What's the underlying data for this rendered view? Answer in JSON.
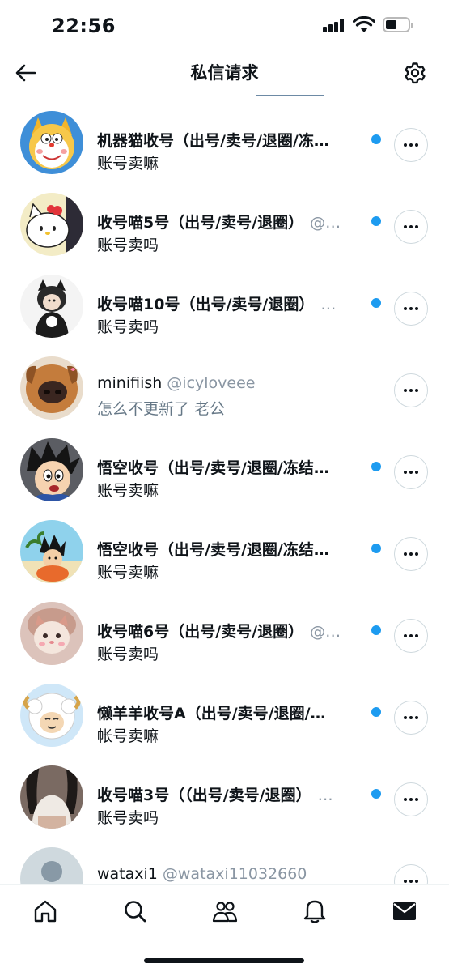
{
  "status_bar": {
    "time": "22:56"
  },
  "header": {
    "title": "私信请求"
  },
  "conversations": [
    {
      "name": "机器猫收号（出号/卖号/退圈/冻…",
      "handle": "",
      "preview": "账号卖嘛",
      "unread": true,
      "avatar": "doraemon-avatar"
    },
    {
      "name": "收号喵5号（出号/卖号/退圈）",
      "handle": "@…",
      "preview": "账号卖吗",
      "unread": true,
      "avatar": "hello-kitty-avatar"
    },
    {
      "name": "收号喵10号（出号/卖号/退圈）",
      "handle": "…",
      "preview": "账号卖吗",
      "unread": true,
      "avatar": "cat-girl-avatar"
    },
    {
      "name": "minifiish",
      "handle": "@icyloveee",
      "preview": "怎么不更新了 老公",
      "unread": false,
      "avatar": "dog-nose-avatar"
    },
    {
      "name": "悟空收号（出号/卖号/退圈/冻结…",
      "handle": "",
      "preview": "账号卖嘛",
      "unread": true,
      "avatar": "goku-avatar"
    },
    {
      "name": "悟空收号（出号/卖号/退圈/冻结…",
      "handle": "",
      "preview": "账号卖嘛",
      "unread": true,
      "avatar": "goku-beach-avatar"
    },
    {
      "name": "收号喵6号（出号/卖号/退圈）",
      "handle": "@…",
      "preview": "账号卖吗",
      "unread": true,
      "avatar": "cat-meme-avatar"
    },
    {
      "name": "懒羊羊收号A（出号/卖号/退圈/…",
      "handle": "",
      "preview": "帐号卖嘛",
      "unread": true,
      "avatar": "lazy-sheep-avatar"
    },
    {
      "name": "收号喵3号（（出号/卖号/退圈）",
      "handle": "…",
      "preview": "账号卖吗",
      "unread": true,
      "avatar": "photo-avatar"
    },
    {
      "name": "wataxi1",
      "handle": "@wataxi11032660",
      "preview": "",
      "unread": false,
      "avatar": "default-avatar"
    }
  ],
  "colors": {
    "unread_dot": "#1d9bf0",
    "text": "#0f1419",
    "muted": "#657786"
  },
  "tab_bar": [
    "home-icon",
    "search-icon",
    "communities-icon",
    "notifications-icon",
    "messages-icon"
  ]
}
